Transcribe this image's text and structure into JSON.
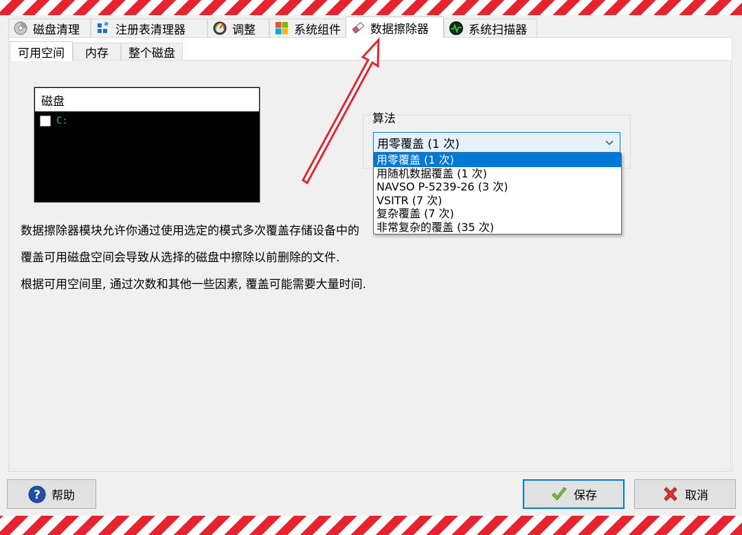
{
  "main_tabs": [
    {
      "label": "磁盘清理",
      "icon": "disk-cleanup-icon"
    },
    {
      "label": "注册表清理器",
      "icon": "registry-cleaner-icon"
    },
    {
      "label": "调整",
      "icon": "tweak-gauge-icon"
    },
    {
      "label": "系统组件",
      "icon": "windows-components-icon"
    },
    {
      "label": "数据擦除器",
      "icon": "eraser-icon",
      "active": true
    },
    {
      "label": "系统扫描器",
      "icon": "system-scanner-icon"
    }
  ],
  "sub_tabs": [
    {
      "label": "可用空间",
      "active": true
    },
    {
      "label": "内存"
    },
    {
      "label": "整个磁盘"
    }
  ],
  "disk_list": {
    "header": "磁盘",
    "items": [
      {
        "label": "C:",
        "checked": false
      }
    ]
  },
  "algorithm": {
    "label": "算法",
    "selected": "用零覆盖 (1 次)",
    "options": [
      "用零覆盖 (1 次)",
      "用随机数据覆盖 (1 次)",
      "NAVSO P-5239-26 (3 次)",
      "VSITR (7 次)",
      "复杂覆盖 (7 次)",
      "非常复杂的覆盖 (35 次)"
    ]
  },
  "description": [
    "数据擦除器模块允许你通过使用选定的模式多次覆盖存储设备中的",
    "覆盖可用磁盘空间会导致从选择的磁盘中擦除以前删除的文件.",
    "根据可用空间里, 通过次数和其他一些因素, 覆盖可能需要大量时间."
  ],
  "buttons": {
    "help": "帮助",
    "save": "保存",
    "cancel": "取消"
  },
  "colors": {
    "stripe_red": "#e8232d",
    "accent": "#0078d7",
    "disk_label_green": "#12d012",
    "annotation_arrow": "#e8232d"
  }
}
